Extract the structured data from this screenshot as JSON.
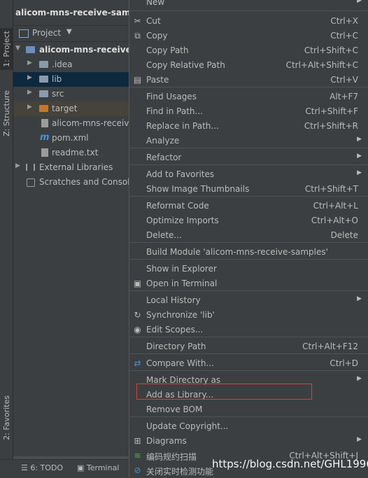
{
  "title": "alicom-mns-receive-samples",
  "left_tabs": [
    {
      "label": "1: Project"
    },
    {
      "label": "Z: Structure"
    },
    {
      "label": "2: Favorites"
    }
  ],
  "panel": {
    "label": "Project"
  },
  "tree": [
    {
      "label": "alicom-mns-receive-s",
      "icon": "module-folder-icon"
    },
    {
      "label": ".idea",
      "icon": "folder-icon"
    },
    {
      "label": "lib",
      "icon": "folder-icon"
    },
    {
      "label": "src",
      "icon": "folder-icon"
    },
    {
      "label": "target",
      "icon": "folder-icon"
    },
    {
      "label": "alicom-mns-receive",
      "icon": "file-icon"
    },
    {
      "label": "pom.xml",
      "icon": "maven-icon"
    },
    {
      "label": "readme.txt",
      "icon": "text-file-icon"
    },
    {
      "label": "External Libraries",
      "icon": "library-icon"
    },
    {
      "label": "Scratches and Console",
      "icon": "scratch-icon"
    }
  ],
  "bottom": {
    "todo": "6: TODO",
    "terminal": "Terminal"
  },
  "menu": [
    {
      "label": "New",
      "shortcut": "",
      "submenu": true
    },
    {
      "label": "Cut",
      "shortcut": "Ctrl+X",
      "icon": "cut-icon"
    },
    {
      "label": "Copy",
      "shortcut": "Ctrl+C",
      "icon": "copy-icon"
    },
    {
      "label": "Copy Path",
      "shortcut": "Ctrl+Shift+C"
    },
    {
      "label": "Copy Relative Path",
      "shortcut": "Ctrl+Alt+Shift+C"
    },
    {
      "label": "Paste",
      "shortcut": "Ctrl+V",
      "icon": "paste-icon"
    },
    {
      "label": "Find Usages",
      "shortcut": "Alt+F7"
    },
    {
      "label": "Find in Path...",
      "shortcut": "Ctrl+Shift+F"
    },
    {
      "label": "Replace in Path...",
      "shortcut": "Ctrl+Shift+R"
    },
    {
      "label": "Analyze",
      "shortcut": "",
      "submenu": true
    },
    {
      "label": "Refactor",
      "shortcut": "",
      "submenu": true
    },
    {
      "label": "Add to Favorites",
      "shortcut": "",
      "submenu": true
    },
    {
      "label": "Show Image Thumbnails",
      "shortcut": "Ctrl+Shift+T"
    },
    {
      "label": "Reformat Code",
      "shortcut": "Ctrl+Alt+L"
    },
    {
      "label": "Optimize Imports",
      "shortcut": "Ctrl+Alt+O"
    },
    {
      "label": "Delete...",
      "shortcut": "Delete"
    },
    {
      "label": "Build Module 'alicom-mns-receive-samples'",
      "shortcut": ""
    },
    {
      "label": "Show in Explorer",
      "shortcut": ""
    },
    {
      "label": "Open in Terminal",
      "shortcut": "",
      "icon": "terminal-icon"
    },
    {
      "label": "Local History",
      "shortcut": "",
      "submenu": true
    },
    {
      "label": "Synchronize 'lib'",
      "shortcut": "",
      "icon": "sync-icon"
    },
    {
      "label": "Edit Scopes...",
      "shortcut": "",
      "icon": "scope-icon"
    },
    {
      "label": "Directory Path",
      "shortcut": "Ctrl+Alt+F12"
    },
    {
      "label": "Compare With...",
      "shortcut": "Ctrl+D",
      "icon": "compare-icon"
    },
    {
      "label": "Mark Directory as",
      "shortcut": "",
      "submenu": true
    },
    {
      "label": "Add as Library...",
      "shortcut": "",
      "highlighted": true
    },
    {
      "label": "Remove BOM",
      "shortcut": ""
    },
    {
      "label": "Update Copyright...",
      "shortcut": ""
    },
    {
      "label": "Diagrams",
      "shortcut": "",
      "submenu": true,
      "icon": "diagram-icon"
    },
    {
      "label": "编码规约扫描",
      "shortcut": "Ctrl+Alt+Shift+J",
      "icon": "scan-icon"
    },
    {
      "label": "关闭实时检测功能",
      "shortcut": "",
      "icon": "disable-icon"
    }
  ],
  "watermark": "https://blog.csdn.net/GHL1996",
  "colors": {
    "accent_highlight_box": "#d64040",
    "selection": "#0d293e"
  }
}
